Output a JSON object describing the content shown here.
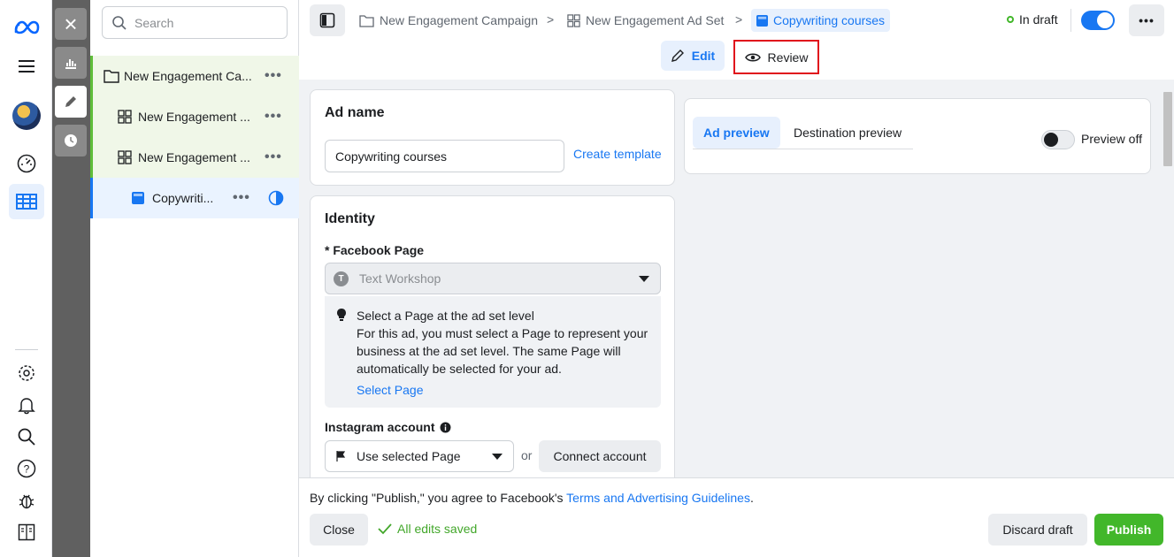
{
  "rail": {
    "icons": [
      "meta-logo-icon",
      "menu-icon",
      "avatar",
      "gauge-icon",
      "table-icon",
      "settings-icon",
      "bell-icon",
      "search-icon",
      "help-icon",
      "bug-icon",
      "panel-icon"
    ],
    "active": "table-icon"
  },
  "tools": {
    "close": "×"
  },
  "tree": {
    "search_placeholder": "Search",
    "items": [
      {
        "label": "New Engagement Ca...",
        "type": "campaign"
      },
      {
        "label": "New Engagement ...",
        "type": "adset"
      },
      {
        "label": "New Engagement ...",
        "type": "adset"
      },
      {
        "label": "Copywriti...",
        "type": "ad"
      }
    ],
    "more": "•••"
  },
  "breadcrumb": {
    "campaign": "New Engagement Campaign",
    "adset": "New Engagement Ad Set",
    "ad": "Copywriting courses"
  },
  "header": {
    "status": "In draft",
    "more": "•••"
  },
  "modes": {
    "edit": "Edit",
    "review": "Review"
  },
  "ad_name": {
    "title": "Ad name",
    "value": "Copywriting courses",
    "create_template": "Create template"
  },
  "identity": {
    "title": "Identity",
    "fb_page_label": "* Facebook Page",
    "fb_page_value": "Text Workshop",
    "fb_page_initial": "T",
    "info_title": "Select a Page at the ad set level",
    "info_body": "For this ad, you must select a Page to represent your business at the ad set level. The same Page will automatically be selected for your ad.",
    "select_page": "Select Page",
    "instagram_label": "Instagram account",
    "instagram_value": "Use selected Page",
    "or": "or",
    "connect": "Connect account"
  },
  "preview": {
    "tab_ad": "Ad preview",
    "tab_destination": "Destination preview",
    "toggle_label": "Preview off"
  },
  "footer": {
    "agree_prefix": "By clicking \"Publish,\" you agree to Facebook's ",
    "agree_link": "Terms and Advertising Guidelines",
    "agree_suffix": ".",
    "close": "Close",
    "saved": "All edits saved",
    "discard": "Discard draft",
    "publish": "Publish"
  },
  "colors": {
    "accent": "#1877f2",
    "publish": "#42b72a",
    "highlight": "#e0101c"
  }
}
